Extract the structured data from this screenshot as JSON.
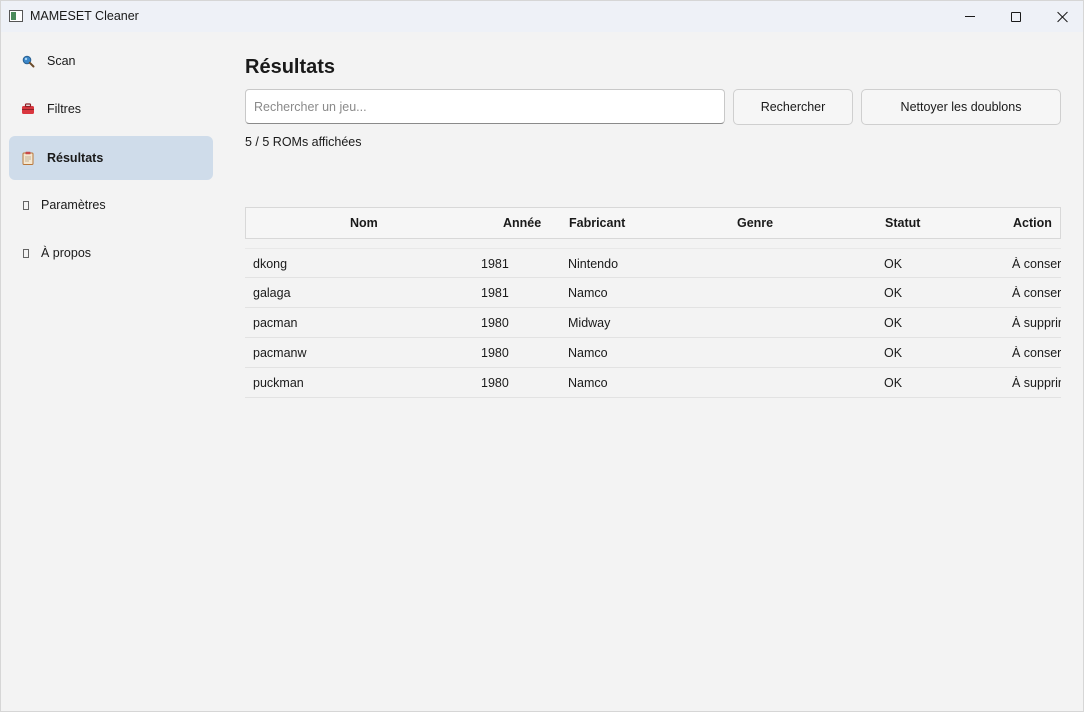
{
  "window": {
    "title": "MAMESET Cleaner"
  },
  "sidebar": {
    "items": [
      {
        "label": "Scan",
        "icon": "magnifier-icon"
      },
      {
        "label": "Filtres",
        "icon": "toolbox-icon"
      },
      {
        "label": "Résultats",
        "icon": "clipboard-icon",
        "active": true
      },
      {
        "label": "Paramètres",
        "icon": "blank-square-icon"
      },
      {
        "label": "À propos",
        "icon": "blank-square-icon"
      }
    ]
  },
  "main": {
    "title": "Résultats",
    "search": {
      "placeholder": "Rechercher un jeu...",
      "value": ""
    },
    "search_button": "Rechercher",
    "clean_button": "Nettoyer les doublons",
    "rom_count": "5 / 5 ROMs affichées",
    "table": {
      "columns": [
        "Nom",
        "Année",
        "Fabricant",
        "Genre",
        "Statut",
        "Action"
      ],
      "rows": [
        {
          "nom": "dkong",
          "annee": "1981",
          "fabricant": "Nintendo",
          "genre": "",
          "statut": "OK",
          "action": "À conserver"
        },
        {
          "nom": "galaga",
          "annee": "1981",
          "fabricant": "Namco",
          "genre": "",
          "statut": "OK",
          "action": "À conserver"
        },
        {
          "nom": "pacman",
          "annee": "1980",
          "fabricant": "Midway",
          "genre": "",
          "statut": "OK",
          "action": "À supprimer"
        },
        {
          "nom": "pacmanw",
          "annee": "1980",
          "fabricant": "Namco",
          "genre": "",
          "statut": "OK",
          "action": "À conserver"
        },
        {
          "nom": "puckman",
          "annee": "1980",
          "fabricant": "Namco",
          "genre": "",
          "statut": "OK",
          "action": "À supprimer"
        }
      ]
    }
  },
  "colors": {
    "active_nav": "#cfdcea",
    "background": "#f3f3f3",
    "titlebar": "#eef1f7"
  }
}
